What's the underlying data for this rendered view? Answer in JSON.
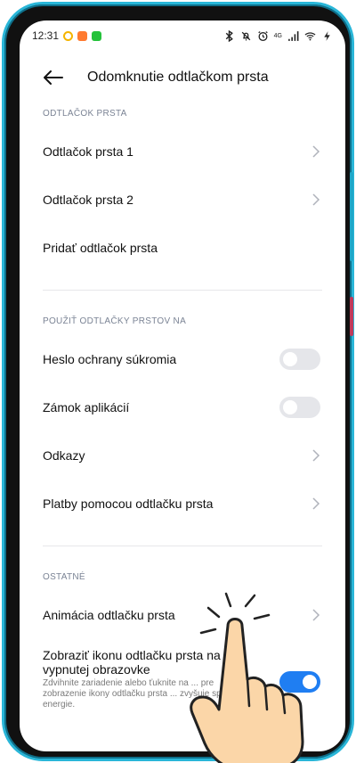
{
  "status": {
    "time": "12:31",
    "network": "4G"
  },
  "header": {
    "title": "Odomknutie odtlačkom prsta"
  },
  "sections": [
    {
      "label": "ODTLAČOK PRSTA",
      "rows": [
        {
          "label": "Odtlačok prsta 1",
          "type": "chevron"
        },
        {
          "label": "Odtlačok prsta 2",
          "type": "chevron"
        },
        {
          "label": "Pridať odtlačok prsta",
          "type": "none"
        }
      ]
    },
    {
      "label": "POUŽIŤ ODTLAČKY PRSTOV NA",
      "rows": [
        {
          "label": "Heslo ochrany súkromia",
          "type": "toggle",
          "on": false
        },
        {
          "label": "Zámok aplikácií",
          "type": "toggle",
          "on": false
        },
        {
          "label": "Odkazy",
          "type": "chevron"
        },
        {
          "label": "Platby pomocou odtlačku prsta",
          "type": "chevron"
        }
      ]
    },
    {
      "label": "OSTATNÉ",
      "rows": [
        {
          "label": "Animácia odtlačku prsta",
          "type": "chevron"
        },
        {
          "label": "Zobraziť ikonu odtlačku prsta na vypnutej obrazovke",
          "description": "Zdvihnite zariadenie alebo ťuknite na ... pre zobrazenie ikony odtlačku prsta ... zvyšuje spotrebu energie.",
          "type": "toggle",
          "on": true
        }
      ]
    }
  ],
  "colors": {
    "accent": "#1f7ef2",
    "frame": "#29b6d8"
  },
  "icons": [
    "back-arrow-icon",
    "chevron-right-icon",
    "tap-gesture-hand-icon"
  ]
}
